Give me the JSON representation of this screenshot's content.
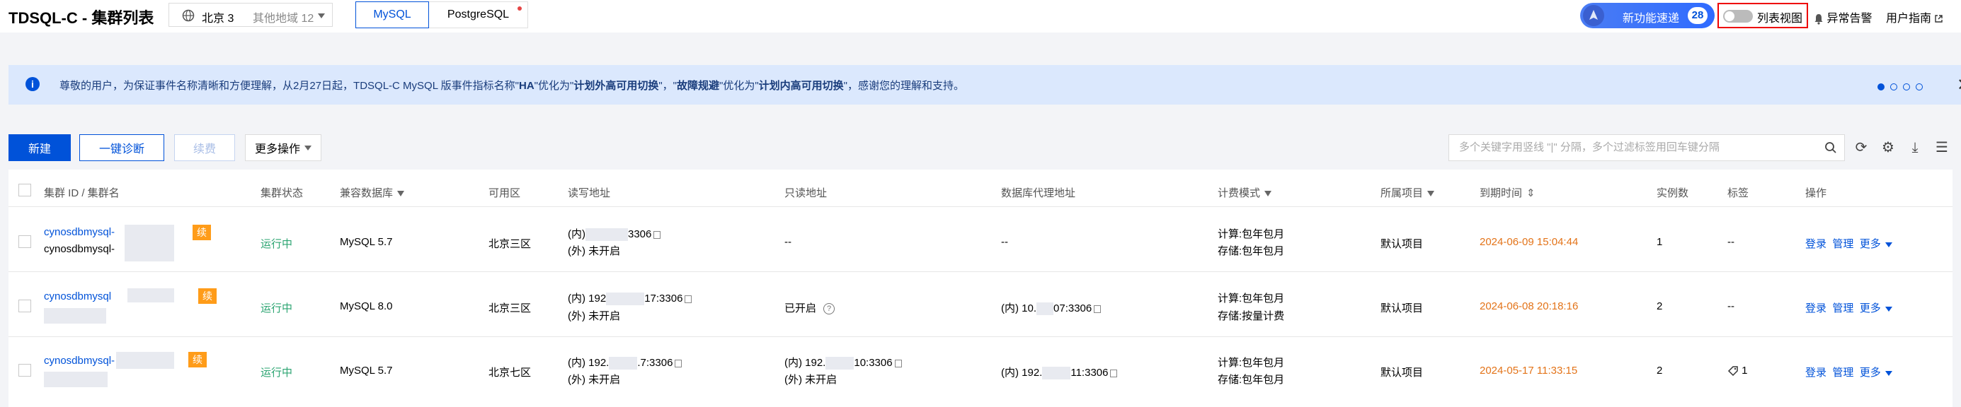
{
  "header": {
    "title": "TDSQL-C - 集群列表",
    "region_current": "北京 3",
    "region_other": "其他地域 12",
    "db_tabs": [
      {
        "label": "MySQL"
      },
      {
        "label": "PostgreSQL"
      }
    ],
    "new_feature_label": "新功能速递",
    "new_feature_count": "28",
    "list_view_label": "列表视图",
    "alarm_label": "异常告警",
    "guide_label": "用户指南"
  },
  "notice": {
    "text_1": "尊敬的用户，为保证事件名称清晰和方便理解，从2月27日起，TDSQL-C MySQL 版事件指标名称\"",
    "bold_1": "HA",
    "text_2": "\"优化为\"",
    "bold_2": "计划外高可用切换",
    "text_3": "\"，\"",
    "bold_3": "故障规避",
    "text_4": "\"优化为\"",
    "bold_4": "计划内高可用切换",
    "text_5": "\"，感谢您的理解和支持。"
  },
  "toolbar": {
    "new_label": "新建",
    "diagnose_label": "一键诊断",
    "renew_label": "续费",
    "more_label": "更多操作",
    "search_placeholder": "多个关键字用竖线 \"|\" 分隔，多个过滤标签用回车键分隔"
  },
  "table": {
    "headers": [
      "集群 ID / 集群名",
      "集群状态",
      "兼容数据库",
      "可用区",
      "读写地址",
      "只读地址",
      "数据库代理地址",
      "计费模式",
      "所属项目",
      "到期时间",
      "实例数",
      "标签",
      "操作"
    ],
    "rows": [
      {
        "id": "cynosdbmysql-",
        "name": "cynosdbmysql-",
        "renew_badge": "续",
        "status": "运行中",
        "db": "MySQL 5.7",
        "zone": "北京三区",
        "rw_in": "(内)",
        "rw_in_port": "3306",
        "rw_out": "(外) 未开启",
        "ro": "--",
        "proxy": "--",
        "billing_1": "计算:包年包月",
        "billing_2": "存储:包年包月",
        "project": "默认项目",
        "expire": "2024-06-09 15:04:44",
        "instances": "1",
        "tags": "--",
        "actions": [
          "登录",
          "管理",
          "更多"
        ]
      },
      {
        "id": "cynosdbmysql",
        "renew_badge": "续",
        "status": "运行中",
        "db": "MySQL 8.0",
        "zone": "北京三区",
        "rw_in": "(内) 192",
        "rw_in_port": "17:3306",
        "rw_out": "(外) 未开启",
        "ro": "已开启",
        "proxy_in": "(内) 10.",
        "proxy_port": "07:3306",
        "billing_1": "计算:包年包月",
        "billing_2": "存储:按量计费",
        "project": "默认项目",
        "expire": "2024-06-08 20:18:16",
        "instances": "2",
        "tags": "--",
        "actions": [
          "登录",
          "管理",
          "更多"
        ]
      },
      {
        "id": "cynosdbmysql-",
        "renew_badge": "续",
        "status": "运行中",
        "db": "MySQL 5.7",
        "zone": "北京七区",
        "rw_in": "(内) 192.",
        "rw_in_port": ".7:3306",
        "rw_out": "(外) 未开启",
        "ro_in": "(内) 192.",
        "ro_port": "10:3306",
        "ro_out": "(外) 未开启",
        "proxy_in": "(内) 192.",
        "proxy_port": "11:3306",
        "billing_1": "计算:包年包月",
        "billing_2": "存储:包年包月",
        "project": "默认项目",
        "expire": "2024-05-17 11:33:15",
        "instances": "2",
        "tags": "1",
        "actions": [
          "登录",
          "管理",
          "更多"
        ]
      }
    ]
  },
  "colors": {
    "primary": "#0052d9",
    "running": "#2ba471",
    "expire": "#e37318",
    "renew_badge": "#ff9c19"
  }
}
